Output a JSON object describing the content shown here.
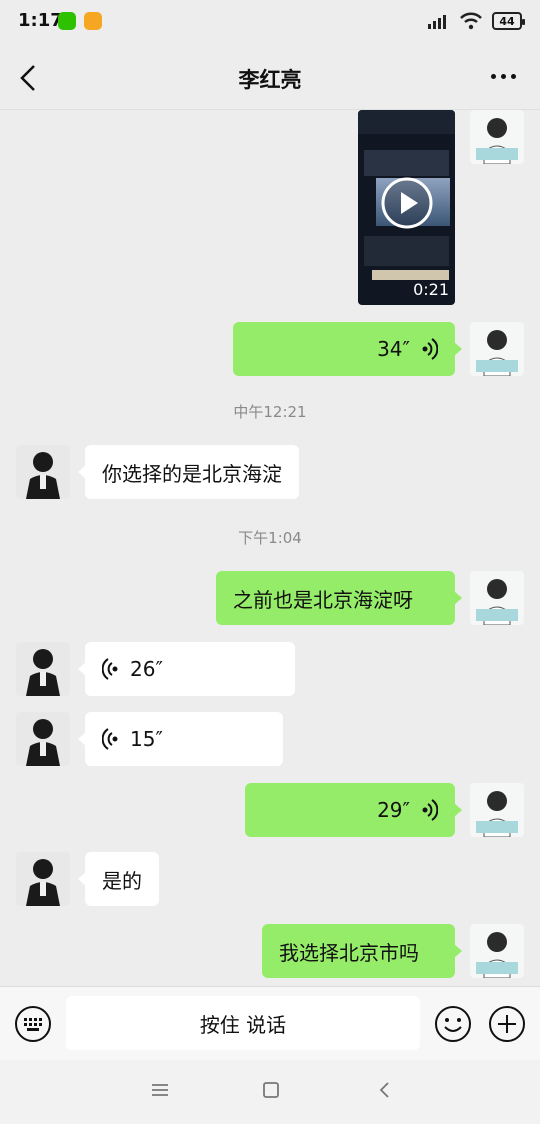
{
  "status_bar": {
    "time": "1:17",
    "battery": "44"
  },
  "header": {
    "title": "李红亮"
  },
  "messages": {
    "video_duration": "0:21",
    "voice_me_1": "34″",
    "time_1": "中午12:21",
    "text_them_1": "你选择的是北京海淀",
    "time_2": "下午1:04",
    "text_me_1": "之前也是北京海淀呀",
    "voice_them_1": "26″",
    "voice_them_2": "15″",
    "voice_me_2": "29″",
    "text_them_2": "是的",
    "text_me_2": "我选择北京市吗"
  },
  "input": {
    "hold_to_talk": "按住 说话"
  },
  "colors": {
    "my_bubble": "#95ec69",
    "their_bubble": "#ffffff",
    "background": "#ededed"
  }
}
